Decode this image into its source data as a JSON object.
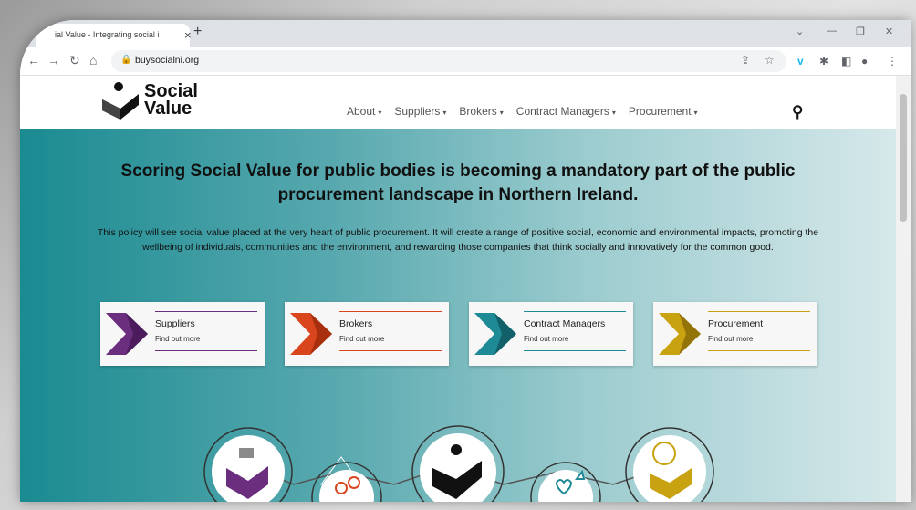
{
  "browser": {
    "tab_title": "ial Value - Integrating social i",
    "url": "buysocialni.org"
  },
  "site": {
    "logo_line1": "Social",
    "logo_line2": "Value",
    "nav": [
      {
        "label": "About"
      },
      {
        "label": "Suppliers"
      },
      {
        "label": "Brokers"
      },
      {
        "label": "Contract Managers"
      },
      {
        "label": "Procurement"
      }
    ]
  },
  "hero": {
    "headline": "Scoring Social Value for public bodies is becoming a mandatory part of the public procurement landscape in Northern Ireland.",
    "paragraph": "This policy will see social value placed at the very heart of public procurement. It will create a range of positive social, economic and environmental impacts, promoting the wellbeing of individuals, communities and the environment, and rewarding those companies that think socially and innovatively for the common good."
  },
  "cards": [
    {
      "title": "Suppliers",
      "link": "Find out more",
      "color": "#6b2d7e"
    },
    {
      "title": "Brokers",
      "link": "Find out more",
      "color": "#d9461e"
    },
    {
      "title": "Contract Managers",
      "link": "Find out more",
      "color": "#1e8a95"
    },
    {
      "title": "Procurement",
      "link": "Find out more",
      "color": "#c9a212"
    }
  ],
  "icons": {
    "back": "arrow-left-icon",
    "forward": "arrow-right-icon",
    "reload": "reload-icon",
    "home": "home-icon",
    "search": "search-icon"
  }
}
